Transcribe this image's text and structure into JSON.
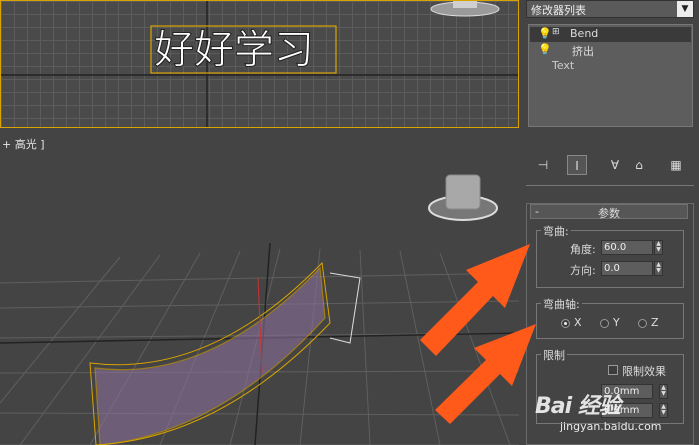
{
  "viewport": {
    "perspective_label": "+ 高光 ]",
    "text_object": "好好学习"
  },
  "panel": {
    "modifier_list_label": "修改器列表",
    "stack": [
      {
        "label": "Bend"
      },
      {
        "label": "挤出"
      },
      {
        "label": "Text"
      }
    ]
  },
  "params": {
    "header": "参数",
    "bend_group": "弯曲:",
    "angle_label": "角度:",
    "angle_value": "60.0",
    "direction_label": "方向:",
    "direction_value": "0.0",
    "axis_group": "弯曲轴:",
    "axes": [
      "X",
      "Y",
      "Z"
    ],
    "limits_group": "限制",
    "limit_effect_label": "限制效果",
    "upper_value": "0.0mm",
    "lower_value": "0.0mm"
  },
  "watermark": {
    "brand": "Bai 经验",
    "url": "jingyan.baidu.com"
  },
  "colors": {
    "selection": "#d9a400",
    "arrow": "#ff5a1a",
    "text_mesh": "#9a7aa8"
  }
}
